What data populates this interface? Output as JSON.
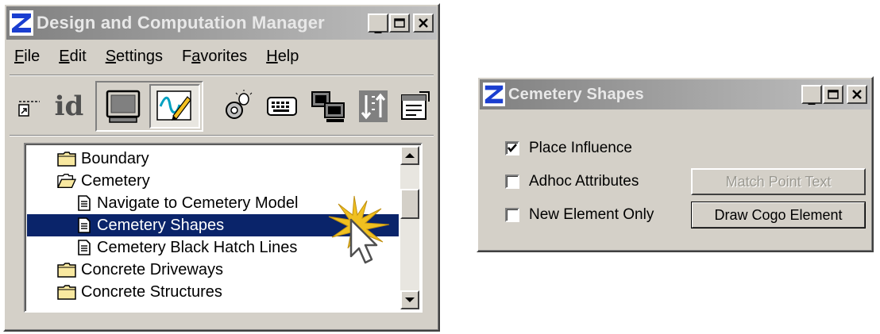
{
  "main_window": {
    "title": "Design and Computation Manager",
    "menu": [
      {
        "label_pre": "",
        "accel": "F",
        "label_post": "ile"
      },
      {
        "label_pre": "",
        "accel": "E",
        "label_post": "dit"
      },
      {
        "label_pre": "",
        "accel": "S",
        "label_post": "ettings"
      },
      {
        "label_pre": "F",
        "accel": "a",
        "label_post": "vorites"
      },
      {
        "label_pre": "",
        "accel": "H",
        "label_post": "elp"
      }
    ],
    "toolbar": {
      "id_label": "id",
      "icons": [
        "dock-icon",
        "id-icon",
        "monitor-icon",
        "design-pen-icon",
        "lightbulb-tool-icon",
        "keyboard-icon",
        "computers-icon",
        "sort-icon",
        "properties-icon"
      ]
    },
    "tree": [
      {
        "label": "Boundary",
        "type": "folder-closed",
        "selected": false
      },
      {
        "label": "Cemetery",
        "type": "folder-open",
        "selected": false
      },
      {
        "label": "Navigate to  Cemetery Model",
        "type": "document",
        "selected": false
      },
      {
        "label": "Cemetery Shapes",
        "type": "document",
        "selected": true
      },
      {
        "label": "Cemetery Black Hatch Lines",
        "type": "document",
        "selected": false
      },
      {
        "label": "Concrete Driveways",
        "type": "folder-closed",
        "selected": false
      },
      {
        "label": "Concrete Structures",
        "type": "folder-closed",
        "selected": false
      }
    ]
  },
  "dialog": {
    "title": "Cemetery Shapes",
    "checkboxes": [
      {
        "label": "Place Influence",
        "checked": true
      },
      {
        "label": "Adhoc Attributes",
        "checked": false
      },
      {
        "label": "New Element Only",
        "checked": false
      }
    ],
    "buttons": [
      {
        "label": "Match Point Text",
        "enabled": false
      },
      {
        "label": "Draw Cogo Element",
        "enabled": true
      }
    ]
  },
  "colors": {
    "selection": "#0a246a",
    "face": "#d4d0c8",
    "titlebar_inactive": "#808080",
    "folder": "#f8e8a0"
  }
}
